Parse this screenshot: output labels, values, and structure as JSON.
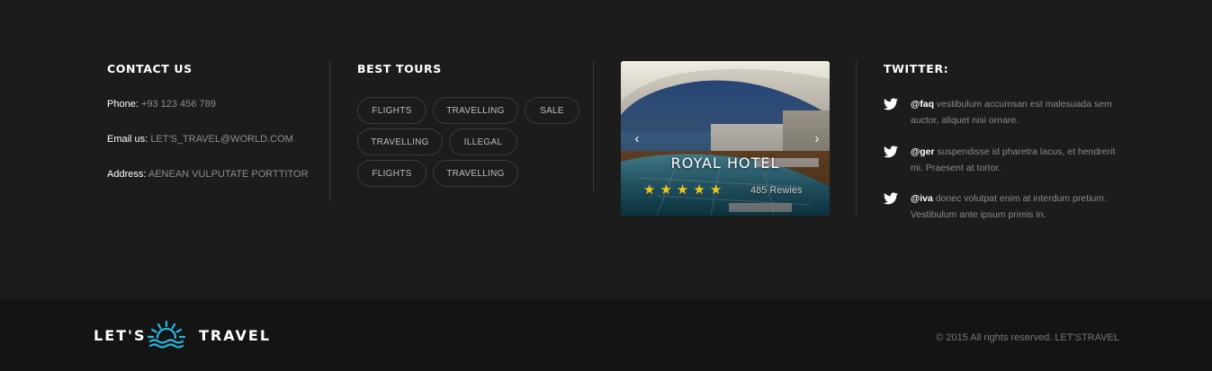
{
  "contact": {
    "heading": "CONTACT US",
    "phone_label": "Phone:",
    "phone_value": "+93 123 456 789",
    "email_label": "Email us:",
    "email_value": "LET'S_TRAVEL@WORLD.COM",
    "address_label": "Address:",
    "address_value": "AENEAN VULPUTATE PORTTITOR"
  },
  "tours": {
    "heading": "BEST TOURS",
    "tags": [
      "FLIGHTS",
      "TRAVELLING",
      "SALE",
      "TRAVELLING",
      "ILLEGAL",
      "FLIGHTS",
      "TRAVELLING"
    ]
  },
  "hotel": {
    "title": "ROYAL HOTEL",
    "rating": 5,
    "rating_max": 5,
    "reviews": "485 Rewies",
    "prev_icon": "chevron-left-icon",
    "next_icon": "chevron-right-icon"
  },
  "twitter": {
    "heading": "TWITTER:",
    "icon": "twitter-bird-icon",
    "tweets": [
      {
        "handle": "@faq",
        "text": " vestibulum accumsan est malesuada sem auctor, aliquet nisi ornare."
      },
      {
        "handle": "@ger",
        "text": " suspendisse id pharetra lacus, et hendrerit mi. Praesent at tortor."
      },
      {
        "handle": "@iva",
        "text": " donec volutpat enim at interdum pretium. Vestibulum ante ipsum primis in."
      }
    ]
  },
  "footer": {
    "logo_left": "LET'S",
    "logo_right": "TRAVEL",
    "logo_icon": "sun-waves-icon",
    "copyright": "© 2015 All rights reserved. LET'STRAVEL"
  },
  "colors": {
    "background": "#1c1c1c",
    "bottom_bar": "#141414",
    "accent": "#29b6e0",
    "star": "#f5c518"
  }
}
